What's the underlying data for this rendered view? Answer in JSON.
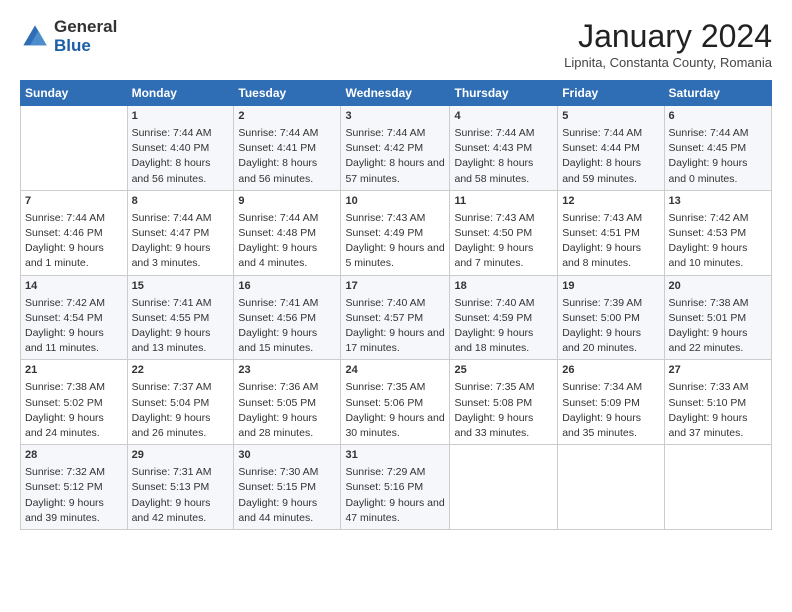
{
  "header": {
    "logo_general": "General",
    "logo_blue": "Blue",
    "month_title": "January 2024",
    "location": "Lipnita, Constanta County, Romania"
  },
  "days_of_week": [
    "Sunday",
    "Monday",
    "Tuesday",
    "Wednesday",
    "Thursday",
    "Friday",
    "Saturday"
  ],
  "weeks": [
    [
      {
        "day": "",
        "sunrise": "",
        "sunset": "",
        "daylight": ""
      },
      {
        "day": "1",
        "sunrise": "Sunrise: 7:44 AM",
        "sunset": "Sunset: 4:40 PM",
        "daylight": "Daylight: 8 hours and 56 minutes."
      },
      {
        "day": "2",
        "sunrise": "Sunrise: 7:44 AM",
        "sunset": "Sunset: 4:41 PM",
        "daylight": "Daylight: 8 hours and 56 minutes."
      },
      {
        "day": "3",
        "sunrise": "Sunrise: 7:44 AM",
        "sunset": "Sunset: 4:42 PM",
        "daylight": "Daylight: 8 hours and 57 minutes."
      },
      {
        "day": "4",
        "sunrise": "Sunrise: 7:44 AM",
        "sunset": "Sunset: 4:43 PM",
        "daylight": "Daylight: 8 hours and 58 minutes."
      },
      {
        "day": "5",
        "sunrise": "Sunrise: 7:44 AM",
        "sunset": "Sunset: 4:44 PM",
        "daylight": "Daylight: 8 hours and 59 minutes."
      },
      {
        "day": "6",
        "sunrise": "Sunrise: 7:44 AM",
        "sunset": "Sunset: 4:45 PM",
        "daylight": "Daylight: 9 hours and 0 minutes."
      }
    ],
    [
      {
        "day": "7",
        "sunrise": "Sunrise: 7:44 AM",
        "sunset": "Sunset: 4:46 PM",
        "daylight": "Daylight: 9 hours and 1 minute."
      },
      {
        "day": "8",
        "sunrise": "Sunrise: 7:44 AM",
        "sunset": "Sunset: 4:47 PM",
        "daylight": "Daylight: 9 hours and 3 minutes."
      },
      {
        "day": "9",
        "sunrise": "Sunrise: 7:44 AM",
        "sunset": "Sunset: 4:48 PM",
        "daylight": "Daylight: 9 hours and 4 minutes."
      },
      {
        "day": "10",
        "sunrise": "Sunrise: 7:43 AM",
        "sunset": "Sunset: 4:49 PM",
        "daylight": "Daylight: 9 hours and 5 minutes."
      },
      {
        "day": "11",
        "sunrise": "Sunrise: 7:43 AM",
        "sunset": "Sunset: 4:50 PM",
        "daylight": "Daylight: 9 hours and 7 minutes."
      },
      {
        "day": "12",
        "sunrise": "Sunrise: 7:43 AM",
        "sunset": "Sunset: 4:51 PM",
        "daylight": "Daylight: 9 hours and 8 minutes."
      },
      {
        "day": "13",
        "sunrise": "Sunrise: 7:42 AM",
        "sunset": "Sunset: 4:53 PM",
        "daylight": "Daylight: 9 hours and 10 minutes."
      }
    ],
    [
      {
        "day": "14",
        "sunrise": "Sunrise: 7:42 AM",
        "sunset": "Sunset: 4:54 PM",
        "daylight": "Daylight: 9 hours and 11 minutes."
      },
      {
        "day": "15",
        "sunrise": "Sunrise: 7:41 AM",
        "sunset": "Sunset: 4:55 PM",
        "daylight": "Daylight: 9 hours and 13 minutes."
      },
      {
        "day": "16",
        "sunrise": "Sunrise: 7:41 AM",
        "sunset": "Sunset: 4:56 PM",
        "daylight": "Daylight: 9 hours and 15 minutes."
      },
      {
        "day": "17",
        "sunrise": "Sunrise: 7:40 AM",
        "sunset": "Sunset: 4:57 PM",
        "daylight": "Daylight: 9 hours and 17 minutes."
      },
      {
        "day": "18",
        "sunrise": "Sunrise: 7:40 AM",
        "sunset": "Sunset: 4:59 PM",
        "daylight": "Daylight: 9 hours and 18 minutes."
      },
      {
        "day": "19",
        "sunrise": "Sunrise: 7:39 AM",
        "sunset": "Sunset: 5:00 PM",
        "daylight": "Daylight: 9 hours and 20 minutes."
      },
      {
        "day": "20",
        "sunrise": "Sunrise: 7:38 AM",
        "sunset": "Sunset: 5:01 PM",
        "daylight": "Daylight: 9 hours and 22 minutes."
      }
    ],
    [
      {
        "day": "21",
        "sunrise": "Sunrise: 7:38 AM",
        "sunset": "Sunset: 5:02 PM",
        "daylight": "Daylight: 9 hours and 24 minutes."
      },
      {
        "day": "22",
        "sunrise": "Sunrise: 7:37 AM",
        "sunset": "Sunset: 5:04 PM",
        "daylight": "Daylight: 9 hours and 26 minutes."
      },
      {
        "day": "23",
        "sunrise": "Sunrise: 7:36 AM",
        "sunset": "Sunset: 5:05 PM",
        "daylight": "Daylight: 9 hours and 28 minutes."
      },
      {
        "day": "24",
        "sunrise": "Sunrise: 7:35 AM",
        "sunset": "Sunset: 5:06 PM",
        "daylight": "Daylight: 9 hours and 30 minutes."
      },
      {
        "day": "25",
        "sunrise": "Sunrise: 7:35 AM",
        "sunset": "Sunset: 5:08 PM",
        "daylight": "Daylight: 9 hours and 33 minutes."
      },
      {
        "day": "26",
        "sunrise": "Sunrise: 7:34 AM",
        "sunset": "Sunset: 5:09 PM",
        "daylight": "Daylight: 9 hours and 35 minutes."
      },
      {
        "day": "27",
        "sunrise": "Sunrise: 7:33 AM",
        "sunset": "Sunset: 5:10 PM",
        "daylight": "Daylight: 9 hours and 37 minutes."
      }
    ],
    [
      {
        "day": "28",
        "sunrise": "Sunrise: 7:32 AM",
        "sunset": "Sunset: 5:12 PM",
        "daylight": "Daylight: 9 hours and 39 minutes."
      },
      {
        "day": "29",
        "sunrise": "Sunrise: 7:31 AM",
        "sunset": "Sunset: 5:13 PM",
        "daylight": "Daylight: 9 hours and 42 minutes."
      },
      {
        "day": "30",
        "sunrise": "Sunrise: 7:30 AM",
        "sunset": "Sunset: 5:15 PM",
        "daylight": "Daylight: 9 hours and 44 minutes."
      },
      {
        "day": "31",
        "sunrise": "Sunrise: 7:29 AM",
        "sunset": "Sunset: 5:16 PM",
        "daylight": "Daylight: 9 hours and 47 minutes."
      },
      {
        "day": "",
        "sunrise": "",
        "sunset": "",
        "daylight": ""
      },
      {
        "day": "",
        "sunrise": "",
        "sunset": "",
        "daylight": ""
      },
      {
        "day": "",
        "sunrise": "",
        "sunset": "",
        "daylight": ""
      }
    ]
  ]
}
